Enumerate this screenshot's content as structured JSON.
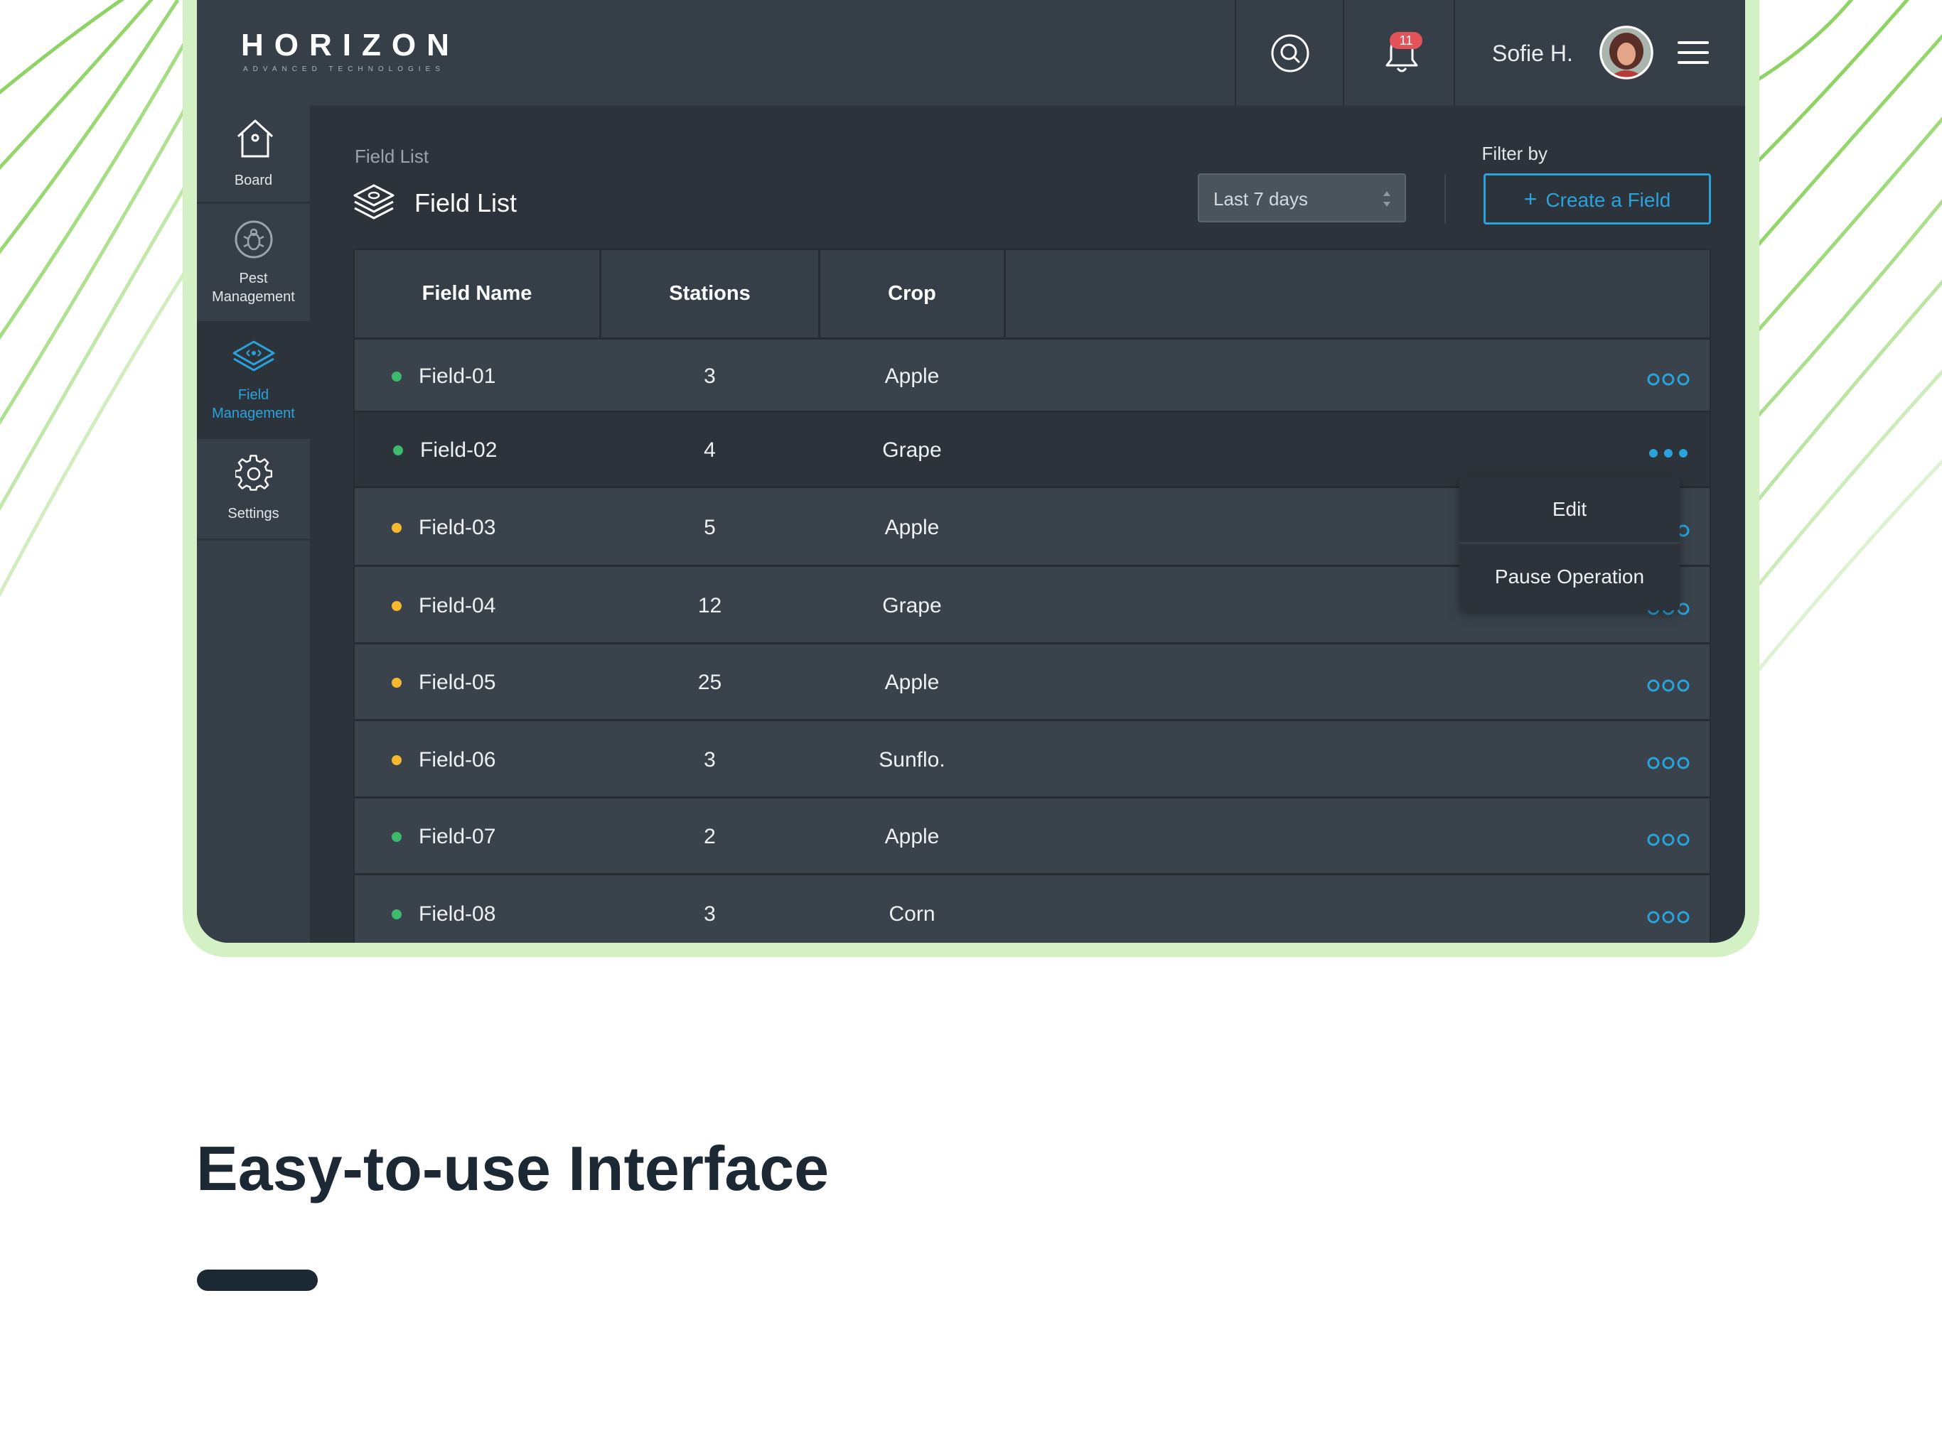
{
  "brand": {
    "name": "HORIZON",
    "tagline": "ADVANCED TECHNOLOGIES"
  },
  "header": {
    "notifications_count": "11",
    "user_name": "Sofie H."
  },
  "sidebar": {
    "items": [
      {
        "label": "Board",
        "icon": "house-icon"
      },
      {
        "label": "Pest\nManagement",
        "icon": "bug-icon"
      },
      {
        "label": "Field\nManagement",
        "icon": "field-layers-icon",
        "active": true
      },
      {
        "label": "Settings",
        "icon": "gear-icon"
      }
    ]
  },
  "page": {
    "breadcrumb": "Field List",
    "title": "Field List",
    "filter_label": "Filter by",
    "filter_value": "Last 7 days",
    "create_button": "Create a Field"
  },
  "table": {
    "columns": [
      "Field Name",
      "Stations",
      "Crop"
    ],
    "rows": [
      {
        "name": "Field-01",
        "stations": "3",
        "crop": "Apple",
        "status": "green"
      },
      {
        "name": "Field-02",
        "stations": "4",
        "crop": "Grape",
        "status": "green",
        "selected": true
      },
      {
        "name": "Field-03",
        "stations": "5",
        "crop": "Apple",
        "status": "yellow"
      },
      {
        "name": "Field-04",
        "stations": "12",
        "crop": "Grape",
        "status": "yellow"
      },
      {
        "name": "Field-05",
        "stations": "25",
        "crop": "Apple",
        "status": "yellow"
      },
      {
        "name": "Field-06",
        "stations": "3",
        "crop": "Sunflo.",
        "status": "yellow"
      },
      {
        "name": "Field-07",
        "stations": "2",
        "crop": "Apple",
        "status": "green"
      },
      {
        "name": "Field-08",
        "stations": "3",
        "crop": "Corn",
        "status": "green"
      }
    ],
    "row_menu": {
      "options": [
        "Edit",
        "Pause Operation"
      ]
    }
  },
  "colors": {
    "accent": "#2aa3dc",
    "status_green": "#3dbb6d",
    "status_yellow": "#f5b82e",
    "badge": "#e4525a",
    "frame": "#d4f1c6"
  },
  "marketing": {
    "headline": "Easy-to-use Interface"
  }
}
